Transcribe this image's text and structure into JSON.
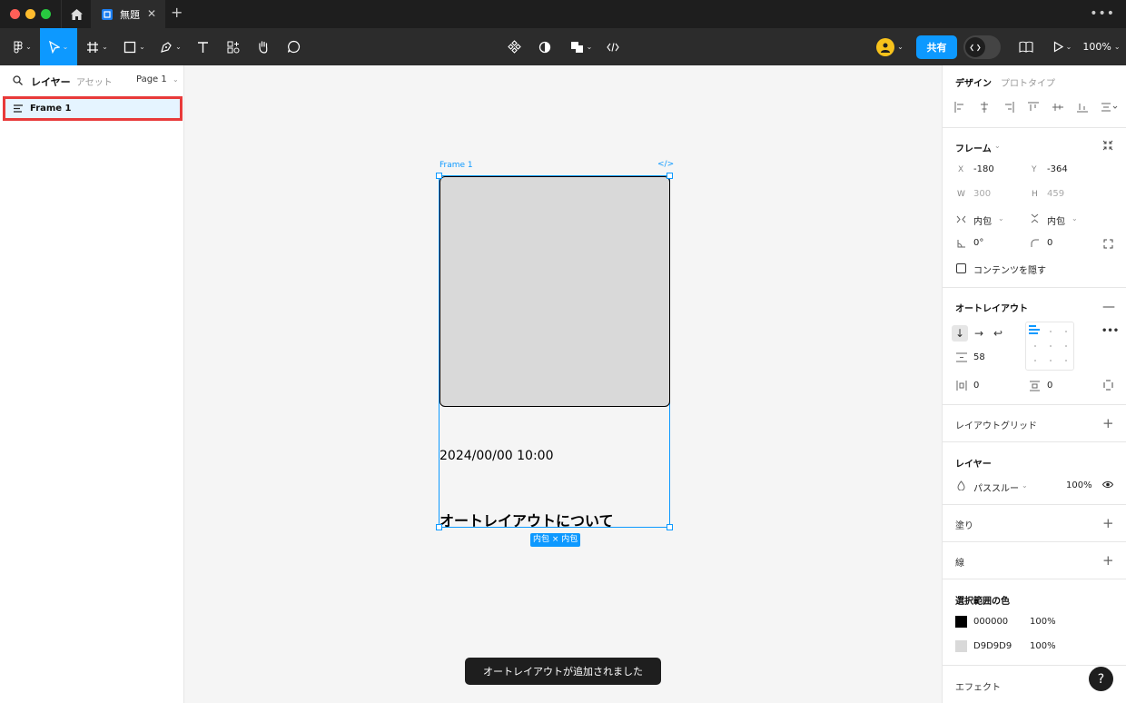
{
  "titlebar": {
    "tab_title": "無題",
    "close_glyph": "✕",
    "add_glyph": "+",
    "more_glyph": "•••"
  },
  "toolbar": {
    "share_label": "共有",
    "zoom": "100%"
  },
  "left_panel": {
    "tab_layers": "レイヤー",
    "tab_assets": "アセット",
    "page_selector": "Page 1",
    "layers": [
      {
        "name": "Frame 1",
        "selected": true
      }
    ]
  },
  "canvas": {
    "frame_label": "Frame 1",
    "code_glyph": "</>",
    "date_text": "2024/00/00 10:00",
    "title_text": "オートレイアウトについて",
    "size_badge": "内包 × 内包",
    "toast": "オートレイアウトが追加されました",
    "image_fill": "#D9D9D9"
  },
  "right_panel": {
    "tab_design": "デザイン",
    "tab_prototype": "プロトタイプ",
    "frame": {
      "title": "フレーム",
      "x_label": "X",
      "x_value": "-180",
      "y_label": "Y",
      "y_value": "-364",
      "w_label": "W",
      "w_value": "300",
      "h_label": "H",
      "h_value": "459",
      "width_mode": "内包",
      "height_mode": "内包",
      "rotation": "0°",
      "radius": "0",
      "clip_content": "コンテンツを隠す"
    },
    "auto_layout": {
      "title": "オートレイアウト",
      "gap": "58",
      "padding_h": "0",
      "padding_v": "0",
      "more_glyph": "•••"
    },
    "layout_grid": {
      "title": "レイアウトグリッド"
    },
    "layer": {
      "title": "レイヤー",
      "blend": "パススルー",
      "opacity": "100%"
    },
    "fill": {
      "title": "塗り"
    },
    "stroke": {
      "title": "線"
    },
    "selection_colors": {
      "title": "選択範囲の色",
      "colors": [
        {
          "hex": "000000",
          "opacity": "100%",
          "swatch": "#000000"
        },
        {
          "hex": "D9D9D9",
          "opacity": "100%",
          "swatch": "#D9D9D9"
        }
      ]
    },
    "effects": {
      "title": "エフェクト"
    }
  },
  "help_glyph": "?",
  "colors": {
    "accent": "#0D99FF",
    "highlight_border": "#E83A3A"
  }
}
